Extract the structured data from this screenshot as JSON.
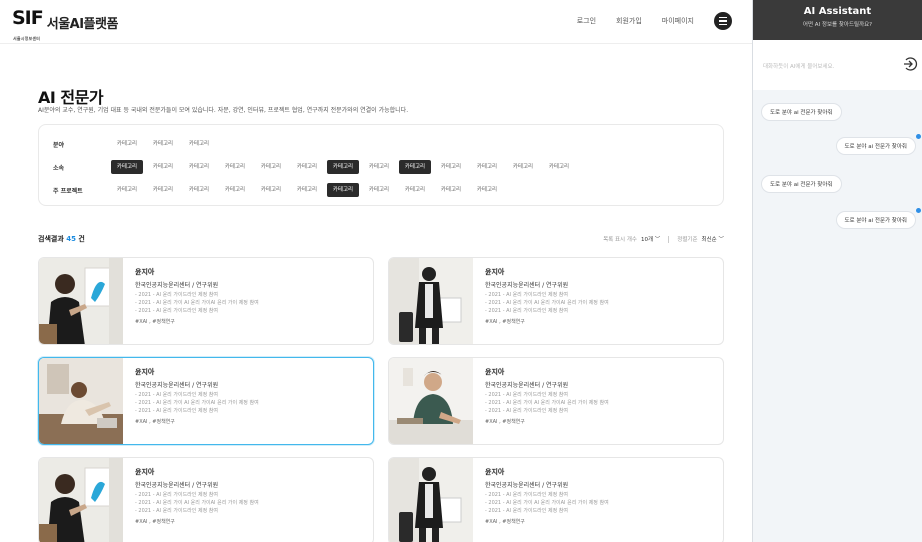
{
  "header": {
    "logo_mark": "SIF",
    "logo_sub": "서울시정보센터",
    "logo_text": "서울AI플랫폼",
    "nav": {
      "login": "로그인",
      "signup": "회원가입",
      "mypage": "마이페이지"
    }
  },
  "page": {
    "title": "AI 전문가",
    "description": "AI분야의 교수, 연구원, 기업 대표 등 국내외 전문가들이 모여 있습니다. 자문, 강연, 인터뷰, 프로젝트 협업, 연구까지 전문가와의 연결이 가능합니다."
  },
  "filters": [
    {
      "label": "분야",
      "chips": [
        "카테고리",
        "카테고리",
        "카테고리"
      ],
      "selected": []
    },
    {
      "label": "소속",
      "chips": [
        "카테고리",
        "카테고리",
        "카테고리",
        "카테고리",
        "카테고리",
        "카테고리",
        "카테고리",
        "카테고리",
        "카테고리",
        "카테고리",
        "카테고리",
        "카테고리",
        "카테고리"
      ],
      "selected": [
        0,
        6,
        8
      ]
    },
    {
      "label": "주 프로젝트",
      "chips": [
        "카테고리",
        "카테고리",
        "카테고리",
        "카테고리",
        "카테고리",
        "카테고리",
        "카테고리",
        "카테고리",
        "카테고리",
        "카테고리",
        "카테고리"
      ],
      "selected": [
        6
      ]
    }
  ],
  "results": {
    "label": "검색결과",
    "count": "45",
    "unit": "건",
    "per_page_label": "목록 표시 개수",
    "per_page_value": "10개",
    "sort_label": "정렬기준",
    "sort_value": "최신순"
  },
  "experts": [
    {
      "name": "윤지아",
      "org": "한국인공지능윤리센터 / 연구위원",
      "history": [
        "- 2021 - AI 윤리 가이드라인 제정 참여",
        "- 2021 - AI 윤리 가이 AI 윤리 가이AI 윤리 가이 제정 참여",
        "- 2021 - AI 윤리 가이드라인 제정 참여"
      ],
      "tags": "#XAI , #정책연구",
      "photo": "a",
      "selected": false
    },
    {
      "name": "윤지아",
      "org": "한국인공지능윤리센터 / 연구위원",
      "history": [
        "- 2021 - AI 윤리 가이드라인 제정 참여",
        "- 2021 - AI 윤리 가이 AI 윤리 가이AI 윤리 가이 제정 참여",
        "- 2021 - AI 윤리 가이드라인 제정 참여"
      ],
      "tags": "#XAI , #정책연구",
      "photo": "b",
      "selected": false
    },
    {
      "name": "윤지아",
      "org": "한국인공지능윤리센터 / 연구위원",
      "history": [
        "- 2021 - AI 윤리 가이드라인 제정 참여",
        "- 2021 - AI 윤리 가이 AI 윤리 가이AI 윤리 가이 제정 참여",
        "- 2021 - AI 윤리 가이드라인 제정 참여"
      ],
      "tags": "#XAI , #정책연구",
      "photo": "c",
      "selected": true
    },
    {
      "name": "윤지아",
      "org": "한국인공지능윤리센터 / 연구위원",
      "history": [
        "- 2021 - AI 윤리 가이드라인 제정 참여",
        "- 2021 - AI 윤리 가이 AI 윤리 가이AI 윤리 가이 제정 참여",
        "- 2021 - AI 윤리 가이드라인 제정 참여"
      ],
      "tags": "#XAI , #정책연구",
      "photo": "d",
      "selected": false
    },
    {
      "name": "윤지아",
      "org": "한국인공지능윤리센터 / 연구위원",
      "history": [
        "- 2021 - AI 윤리 가이드라인 제정 참여",
        "- 2021 - AI 윤리 가이 AI 윤리 가이AI 윤리 가이 제정 참여",
        "- 2021 - AI 윤리 가이드라인 제정 참여"
      ],
      "tags": "#XAI , #정책연구",
      "photo": "a",
      "selected": false
    },
    {
      "name": "윤지아",
      "org": "한국인공지능윤리센터 / 연구위원",
      "history": [
        "- 2021 - AI 윤리 가이드라인 제정 참여",
        "- 2021 - AI 윤리 가이 AI 윤리 가이AI 윤리 가이 제정 참여",
        "- 2021 - AI 윤리 가이드라인 제정 참여"
      ],
      "tags": "#XAI , #정책연구",
      "photo": "b",
      "selected": false
    }
  ],
  "assistant": {
    "title": "AI Assistant",
    "subtitle": "어떤 AI 정보를 찾아드릴까요?",
    "input_placeholder": "대화하듯이 AI에게 물어보세요.",
    "messages": [
      {
        "side": "left",
        "text": "도로 분야 ai 전문가 찾아줘"
      },
      {
        "side": "right",
        "text": "도로 분야 ai 전문가 찾아줘"
      },
      {
        "side": "left",
        "text": "도로 분야 ai 전문가 찾아줘"
      },
      {
        "side": "right",
        "text": "도로 분야 ai 전문가 찾아줘"
      }
    ]
  },
  "colors": {
    "accent": "#1a8be0",
    "selected_border": "#43b8ec",
    "chip_on": "#2b2b2b",
    "panel_head": "#3a3a3a"
  },
  "icons": {
    "menu": "hamburger-icon",
    "send": "send-icon"
  }
}
